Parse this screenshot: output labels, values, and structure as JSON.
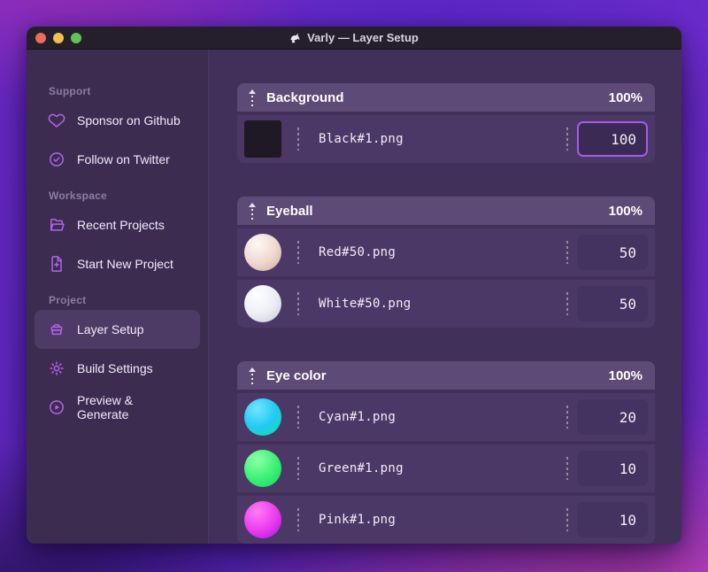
{
  "colors": {
    "accent": "#a55ce8",
    "icon_accent": "#b264ea",
    "traffic_red": "#ee6a5f",
    "traffic_yellow": "#f5bd4f",
    "traffic_green": "#61c454"
  },
  "window": {
    "title": "Varly — Layer Setup",
    "app_icon": "unicorn-icon"
  },
  "sidebar": {
    "sections": [
      {
        "label": "Support",
        "items": [
          {
            "icon": "heart",
            "label": "Sponsor on Github"
          },
          {
            "icon": "check-badge",
            "label": "Follow on Twitter"
          }
        ]
      },
      {
        "label": "Workspace",
        "items": [
          {
            "icon": "folder-open",
            "label": "Recent Projects"
          },
          {
            "icon": "file-plus",
            "label": "Start New Project"
          }
        ]
      },
      {
        "label": "Project",
        "items": [
          {
            "icon": "layers",
            "label": "Layer Setup",
            "active": true
          },
          {
            "icon": "gear",
            "label": "Build Settings"
          },
          {
            "icon": "play-circle",
            "label": "Preview & Generate"
          }
        ]
      }
    ]
  },
  "groups": [
    {
      "name": "Background",
      "weight": "100%",
      "layers": [
        {
          "file": "Black#1.png",
          "value": "100",
          "focused": true,
          "thumb": {
            "type": "square",
            "colors": [
              "#1f1825"
            ]
          }
        }
      ]
    },
    {
      "name": "Eyeball",
      "weight": "100%",
      "layers": [
        {
          "file": "Red#50.png",
          "value": "50",
          "thumb": {
            "type": "sphere",
            "colors": [
              "#fff7f3",
              "#efd9d0",
              "#cfa89e"
            ]
          }
        },
        {
          "file": "White#50.png",
          "value": "50",
          "thumb": {
            "type": "sphere",
            "colors": [
              "#ffffff",
              "#eceef4",
              "#c6c6d4"
            ]
          }
        }
      ]
    },
    {
      "name": "Eye color",
      "weight": "100%",
      "layers": [
        {
          "file": "Cyan#1.png",
          "value": "20",
          "thumb": {
            "type": "sphere",
            "colors": [
              "#6fe6ff",
              "#22c9f2",
              "#12e2a2"
            ]
          }
        },
        {
          "file": "Green#1.png",
          "value": "10",
          "thumb": {
            "type": "sphere",
            "colors": [
              "#8effa9",
              "#3cf276",
              "#0fd45c"
            ]
          }
        },
        {
          "file": "Pink#1.png",
          "value": "10",
          "thumb": {
            "type": "sphere",
            "colors": [
              "#ff7df2",
              "#ec3cf0",
              "#a316d6"
            ]
          }
        }
      ]
    }
  ]
}
